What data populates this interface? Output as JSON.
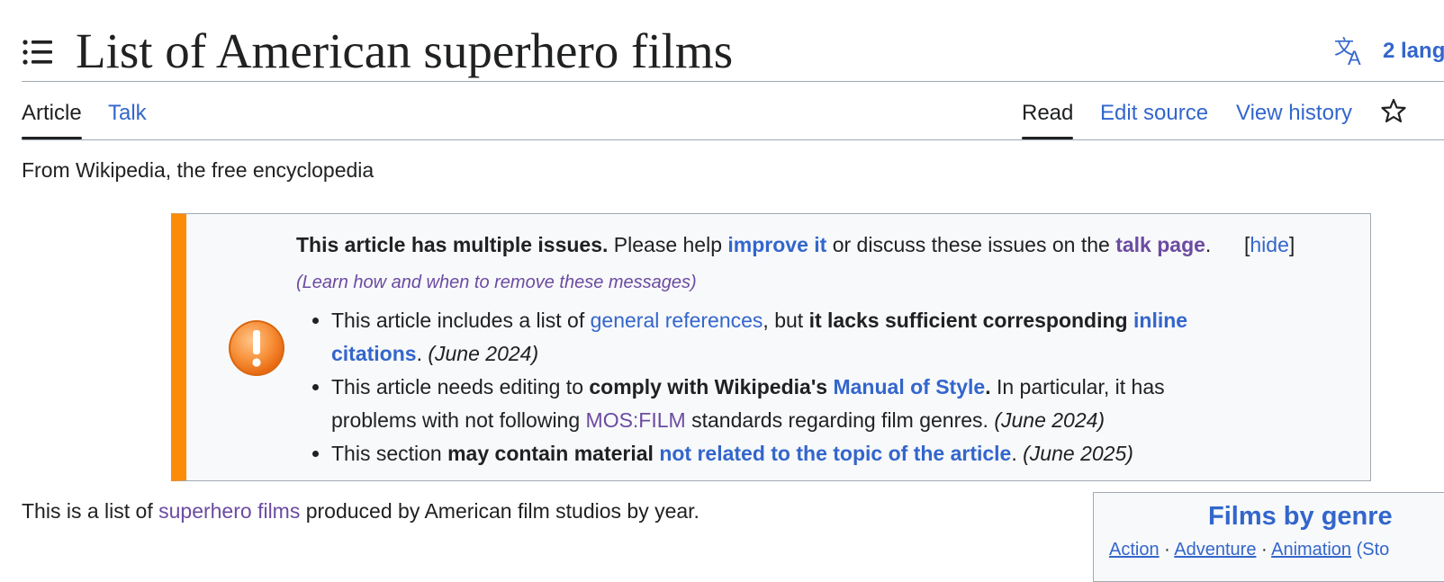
{
  "header": {
    "title": "List of American superhero films",
    "languages_label": "2 lang"
  },
  "tabs": {
    "article": "Article",
    "talk": "Talk",
    "read": "Read",
    "edit_source": "Edit source",
    "view_history": "View history"
  },
  "tagline": "From Wikipedia, the free encyclopedia",
  "issues": {
    "intro_bold": "This article has multiple issues.",
    "intro_text1": " Please help ",
    "improve_link": "improve it",
    "intro_text2": " or discuss these issues on the ",
    "talk_link": "talk page",
    "intro_text3": ". ",
    "learn_link": "(Learn how and when to remove these messages)",
    "hide_open": "[",
    "hide_label": "hide",
    "hide_close": "]",
    "item1": {
      "text1": "This article includes a list of ",
      "link1": "general references",
      "text2": ", but ",
      "bold": "it lacks sufficient corresponding",
      "text3": " ",
      "link2": "inline citations",
      "text4": ". ",
      "date": "(June 2024)"
    },
    "item2": {
      "text1": "This article needs editing to ",
      "bold": "comply with Wikipedia's",
      "text2": " ",
      "link1": "Manual of Style",
      "bold2": ".",
      "text3": " In particular, it has problems with not following ",
      "link2": "MOS:FILM",
      "text4": " standards regarding film genres. ",
      "date": "(June 2024)"
    },
    "item3": {
      "text1": "This section ",
      "bold": "may contain material",
      "text2": " ",
      "link1": "not related to the topic of the article",
      "text3": ". ",
      "date": "(June 2025)"
    }
  },
  "intro": {
    "text1": "This is a list of ",
    "link": "superhero films",
    "text2": " produced by American film studios by year."
  },
  "genre_box": {
    "title": "Films by genre",
    "link1": "Action",
    "sep1": " · ",
    "link2": "Adventure",
    "sep2": " · ",
    "link3": "Animation",
    "tail": " (Sto"
  },
  "colors": {
    "link": "#3366cc",
    "visited_link": "#6b4ba1",
    "issue_bar": "#fc8b0a",
    "box_bg": "#f8f9fa",
    "border": "#a2a9b1"
  },
  "icons": {
    "toc": "toc-list-icon",
    "language": "language-translate-icon",
    "watch": "star-icon",
    "warning": "warning-exclamation-icon"
  }
}
